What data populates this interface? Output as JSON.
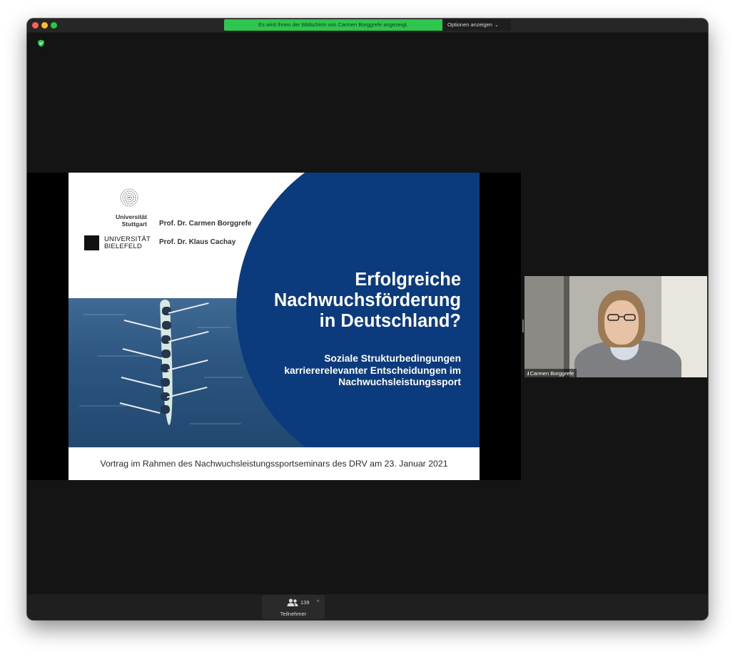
{
  "window": {
    "share_banner": "Es wird Ihnen der Bildschirm von Carmen Borggrefe angezeigt.",
    "options_label": "Optionen anzeigen",
    "options_chevron": "⌄"
  },
  "slide": {
    "uni_stuttgart": "Universität\nStuttgart",
    "uni_bielefeld": "UNIVERSITÄT\nBIELEFELD",
    "author1": "Prof. Dr. Carmen Borggrefe",
    "author2": "Prof. Dr. Klaus Cachay",
    "title": "Erfolgreiche\nNachwuchsförderung\nin Deutschland?",
    "subtitle": "Soziale Strukturbedingungen\nkarriererelevanter Entscheidungen im\nNachwuchsleistungssport",
    "footer": "Vortrag im Rahmen des Nachwuchsleistungssportseminars des DRV am 23. Januar 2021"
  },
  "video": {
    "participant_name": "Carmen Borggrefe",
    "signal_icon": "signal-bars-icon"
  },
  "toolbar": {
    "participants_label": "Teilnehmer",
    "participants_count": "139",
    "caret": "^"
  },
  "colors": {
    "banner_green": "#2ec64f",
    "slide_blue": "#0b3b7d",
    "window_bg": "#141414",
    "security_green": "#2dc84d"
  }
}
